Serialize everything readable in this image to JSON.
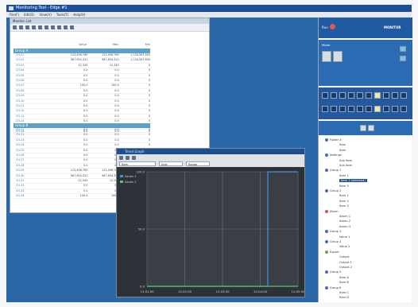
{
  "window": {
    "title": "Monitoring Tool - Edge #1"
  },
  "menubar": [
    "File(F)",
    "Edit(E)",
    "View(V)",
    "Tools(T)",
    "Help(H)"
  ],
  "list_window": {
    "title": "Monitor List",
    "columns": [
      "Value",
      "Max",
      "Min"
    ],
    "section1": {
      "title": "Group A",
      "rows": [
        {
          "name": "CH-01",
          "v": "123,456,789",
          "max": "123,456,789",
          "min": "1,234,567,890"
        },
        {
          "name": "CH-02",
          "v": "987,654,321",
          "max": "987,654,321",
          "min": "1,234,567,890"
        },
        {
          "name": "CH-03",
          "v": "12,345",
          "max": "12,345",
          "min": "0"
        },
        {
          "name": "CH-04",
          "v": "0.0",
          "max": "0.0",
          "min": "0"
        },
        {
          "name": "CH-05",
          "v": "0.0",
          "max": "0.0",
          "min": "0"
        },
        {
          "name": "CH-06",
          "v": "0.0",
          "max": "0.0",
          "min": "0"
        },
        {
          "name": "CH-07",
          "v": "100.0",
          "max": "100.0",
          "min": "0"
        },
        {
          "name": "CH-08",
          "v": "0.0",
          "max": "0.0",
          "min": "0"
        },
        {
          "name": "CH-09",
          "v": "0.0",
          "max": "0.0",
          "min": "0"
        },
        {
          "name": "CH-10",
          "v": "0.0",
          "max": "0.0",
          "min": "0"
        },
        {
          "name": "CH-11",
          "v": "0.0",
          "max": "0.0",
          "min": "0"
        },
        {
          "name": "CH-12",
          "v": "0.0",
          "max": "0.0",
          "min": "0"
        },
        {
          "name": "CH-13",
          "v": "0.0",
          "max": "0.0",
          "min": "0"
        },
        {
          "name": "CH-14",
          "v": "0.0",
          "max": "0.0",
          "min": "0"
        },
        {
          "name": "CH-15",
          "v": "0.0",
          "max": "0.0",
          "min": "0"
        },
        {
          "name": "CH-16",
          "v": "0.0",
          "max": "0.0",
          "min": "0"
        }
      ]
    },
    "section2": {
      "title": "Group B",
      "rows": [
        {
          "name": "CH-21",
          "v": "0.0",
          "max": "0.0",
          "min": "0"
        },
        {
          "name": "CH-22",
          "v": "0.0",
          "max": "0.0",
          "min": "0"
        },
        {
          "name": "CH-23",
          "v": "0.0",
          "max": "0.0",
          "min": "0"
        },
        {
          "name": "CH-24",
          "v": "0.0",
          "max": "0.0",
          "min": "0"
        },
        {
          "name": "CH-25",
          "v": "0.0",
          "max": "0.0",
          "min": "0"
        },
        {
          "name": "CH-26",
          "v": "0.0",
          "max": "0.0",
          "min": "0"
        },
        {
          "name": "CH-27",
          "v": "0.0",
          "max": "0.0",
          "min": "0"
        },
        {
          "name": "CH-28",
          "v": "0.0",
          "max": "0.0",
          "min": "0"
        },
        {
          "name": "CH-29",
          "v": "123,456,789",
          "max": "123,456,789",
          "min": "1,234,567,890"
        },
        {
          "name": "CH-30",
          "v": "987,654,321",
          "max": "987,654,321",
          "min": "1,234,567,890"
        },
        {
          "name": "CH-31",
          "v": "12,345",
          "max": "12,345",
          "min": "0"
        },
        {
          "name": "CH-32",
          "v": "0.0",
          "max": "0.0",
          "min": "0"
        },
        {
          "name": "CH-33",
          "v": "0.0",
          "max": "0.0",
          "min": "0"
        },
        {
          "name": "CH-34",
          "v": "100.0",
          "max": "100.0",
          "min": "0"
        }
      ]
    }
  },
  "chart_window": {
    "title": "Trend Graph",
    "selectors": [
      "Item",
      "Axis",
      "Range"
    ],
    "legend": [
      "Series 1",
      "Series 2"
    ],
    "colors": {
      "plot_bg": "#3a3f47",
      "grid": "#6e737b",
      "line_blue": "#4a8fd8",
      "line_green": "#5fbf6a"
    }
  },
  "chart_data": {
    "type": "line",
    "x": [
      "12:01:00",
      "12:02:00",
      "12:03:00",
      "12:04:00",
      "12:05:00"
    ],
    "y_ticks": [
      "100.0",
      "50.0",
      "0.0"
    ],
    "ylim": [
      0,
      100
    ],
    "series": [
      {
        "name": "Series 1",
        "values": [
          0,
          0,
          0,
          0,
          100,
          100
        ]
      },
      {
        "name": "Series 2",
        "values": [
          0,
          0,
          0,
          0,
          0,
          0
        ]
      }
    ]
  },
  "right_panel": {
    "top_label": "Run",
    "logo": "MONITOR",
    "mode_label": "Mode",
    "tree": [
      "Folder A",
      "Item",
      "Item",
      "Settings",
      "Sub item",
      "Sub item",
      "Group 1",
      "Item 1",
      "Item 2 (selected)",
      "Item 3",
      "Group 2",
      "Item 1",
      "Item 2",
      "Item 3",
      "Alarm",
      "Alarm 1",
      "Alarm 2",
      "Alarm 3",
      "Group 3",
      "Value 1",
      "Group 4",
      "Value 2",
      "Export",
      "Output",
      "Output 1",
      "Output 2",
      "Group 5",
      "Item A",
      "Item B",
      "Group 6",
      "Item C",
      "Item D"
    ]
  }
}
